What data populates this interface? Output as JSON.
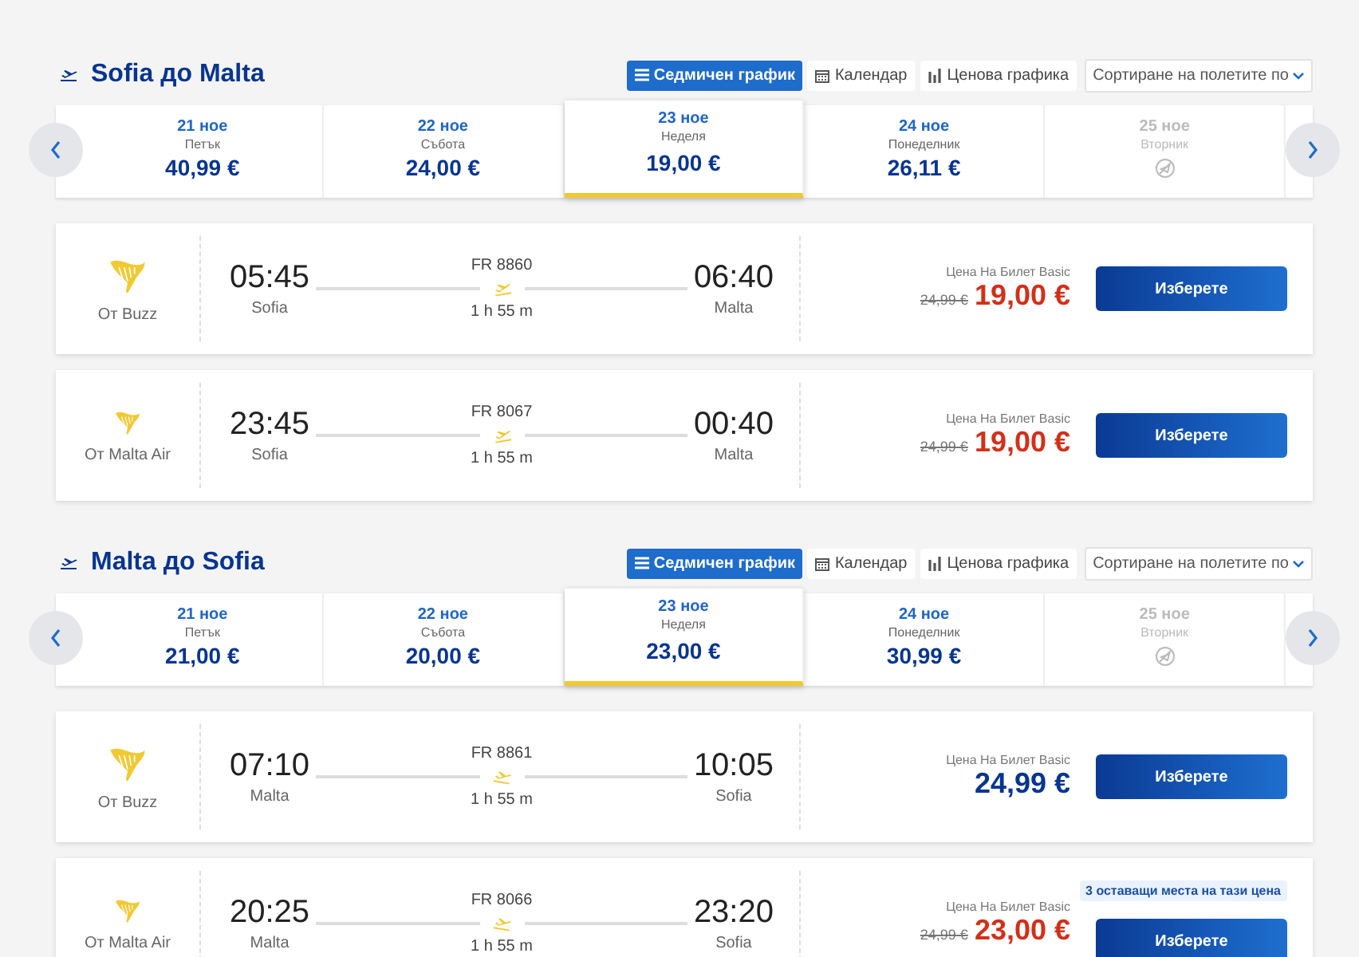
{
  "sections": [
    {
      "title": "Sofia до Malta",
      "views": [
        {
          "label": "Седмичен график",
          "kind": "list",
          "selected": true
        },
        {
          "label": "Календар",
          "kind": "calendar",
          "selected": false
        },
        {
          "label": "Ценова графика",
          "kind": "chart",
          "selected": false
        }
      ],
      "sort": "Сортиране на полетите по",
      "dates": [
        {
          "date": "21 ное",
          "day": "Петък",
          "price": "40,99 €",
          "selected": false,
          "disabled": false
        },
        {
          "date": "22 ное",
          "day": "Събота",
          "price": "24,00 €",
          "selected": false,
          "disabled": false
        },
        {
          "date": "23 ное",
          "day": "Неделя",
          "price": "19,00 €",
          "selected": true,
          "disabled": false
        },
        {
          "date": "24 ное",
          "day": "Понеделник",
          "price": "26,11 €",
          "selected": false,
          "disabled": false
        },
        {
          "date": "25 ное",
          "day": "Вторник",
          "selected": false,
          "disabled": true
        }
      ],
      "flights": [
        {
          "airline": "От Buzz",
          "kind": "large",
          "dep": "05:45",
          "from": "Sofia",
          "number": "FR 8860",
          "duration": "1 h 55 m",
          "arr": "06:40",
          "to": "Malta",
          "price_label": "Цена На Билет Basic",
          "old_price": "24,99 €",
          "price": "19,00 €",
          "sale": true,
          "button": "Изберете"
        },
        {
          "airline": "От Malta Air",
          "kind": "small",
          "dep": "23:45",
          "from": "Sofia",
          "number": "FR 8067",
          "duration": "1 h 55 m",
          "arr": "00:40",
          "to": "Malta",
          "price_label": "Цена На Билет Basic",
          "old_price": "24,99 €",
          "price": "19,00 €",
          "sale": true,
          "button": "Изберете"
        }
      ]
    },
    {
      "title": "Malta до Sofia",
      "views": [
        {
          "label": "Седмичен график",
          "kind": "list",
          "selected": true
        },
        {
          "label": "Календар",
          "kind": "calendar",
          "selected": false
        },
        {
          "label": "Ценова графика",
          "kind": "chart",
          "selected": false
        }
      ],
      "sort": "Сортиране на полетите по",
      "dates": [
        {
          "date": "21 ное",
          "day": "Петък",
          "price": "21,00 €",
          "selected": false,
          "disabled": false
        },
        {
          "date": "22 ное",
          "day": "Събота",
          "price": "20,00 €",
          "selected": false,
          "disabled": false
        },
        {
          "date": "23 ное",
          "day": "Неделя",
          "price": "23,00 €",
          "selected": true,
          "disabled": false
        },
        {
          "date": "24 ное",
          "day": "Понеделник",
          "price": "30,99 €",
          "selected": false,
          "disabled": false
        },
        {
          "date": "25 ное",
          "day": "Вторник",
          "selected": false,
          "disabled": true
        }
      ],
      "flights": [
        {
          "airline": "От Buzz",
          "kind": "large",
          "dep": "07:10",
          "from": "Malta",
          "number": "FR 8861",
          "duration": "1 h 55 m",
          "arr": "10:05",
          "to": "Sofia",
          "price_label": "Цена На Билет Basic",
          "price": "24,99 €",
          "sale": false,
          "button": "Изберете"
        },
        {
          "airline": "От Malta Air",
          "kind": "small",
          "dep": "20:25",
          "from": "Malta",
          "number": "FR 8066",
          "duration": "1 h 55 m",
          "arr": "23:20",
          "to": "Sofia",
          "badge": "3 оставащи места на тази цена",
          "price_label": "Цена На Билет Basic",
          "old_price": "24,99 €",
          "price": "23,00 €",
          "sale": true,
          "button": "Изберете"
        }
      ]
    }
  ]
}
